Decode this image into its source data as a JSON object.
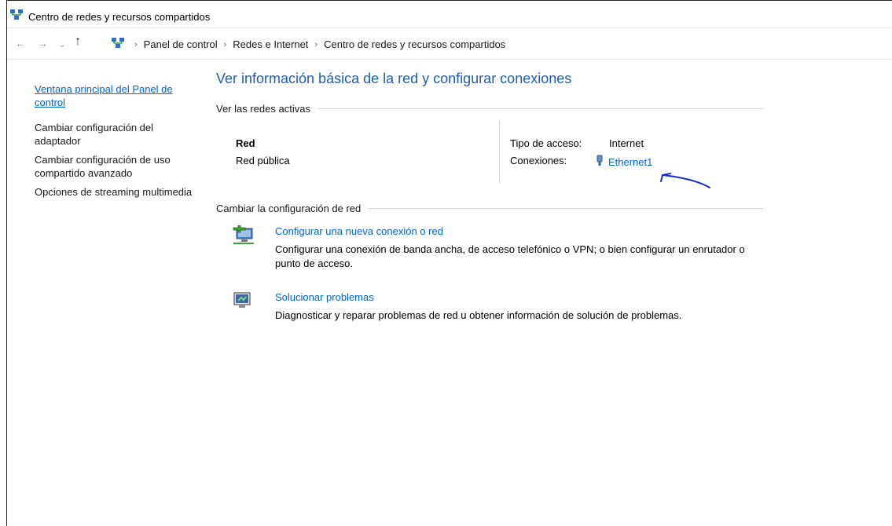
{
  "window": {
    "title": "Centro de redes y recursos compartidos"
  },
  "address": {
    "back_icon": "arrow-left-icon",
    "forward_icon": "arrow-right-icon",
    "recent_icon": "chevron-down-icon",
    "up_icon": "arrow-up-icon",
    "breadcrumbs": [
      "Panel de control",
      "Redes e Internet",
      "Centro de redes y recursos compartidos"
    ]
  },
  "sidebar": {
    "items": [
      {
        "label": "Ventana principal del Panel de control"
      },
      {
        "label": "Cambiar configuración del adaptador"
      },
      {
        "label": "Cambiar configuración de uso compartido avanzado"
      },
      {
        "label": "Opciones de streaming multimedia"
      }
    ]
  },
  "main": {
    "heading": "Ver información básica de la red y configurar conexiones",
    "active_networks": {
      "section_title": "Ver las redes activas",
      "network_name": "Red",
      "network_type": "Red pública",
      "access_type_label": "Tipo de acceso:",
      "access_type_value": "Internet",
      "connections_label": "Conexiones:",
      "connection_name": "Ethernet1"
    },
    "change_settings": {
      "section_title": "Cambiar la configuración de red",
      "tasks": [
        {
          "link": "Configurar una nueva conexión o red",
          "description": "Configurar una conexión de banda ancha, de acceso telefónico o VPN; o bien configurar un enrutador o punto de acceso.",
          "icon": "new-connection-icon"
        },
        {
          "link": "Solucionar problemas",
          "description": "Diagnosticar y reparar problemas de red u obtener información de solución de problemas.",
          "icon": "troubleshoot-icon"
        }
      ]
    }
  },
  "colors": {
    "link": "#0066cc",
    "heading": "#1f5fa8",
    "annotation": "#1a2bd6"
  }
}
